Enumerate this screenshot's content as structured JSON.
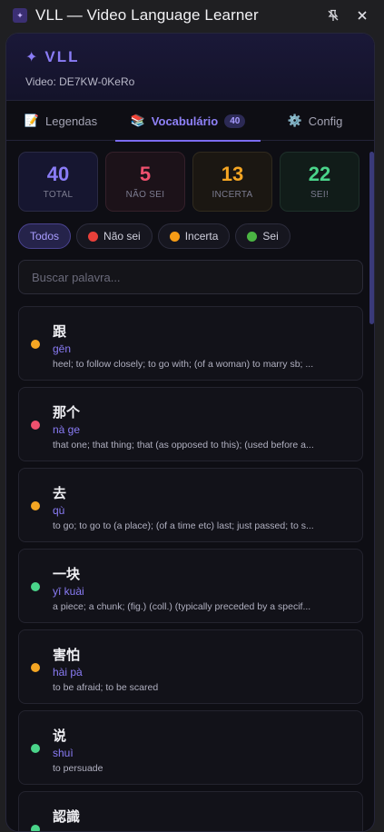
{
  "window": {
    "title": "VLL — Video Language Learner",
    "icon": "app-logo-icon",
    "pin_icon": "pin-off-icon",
    "close_icon": "close-icon"
  },
  "header": {
    "brand_icon": "✦",
    "brand": "VLL",
    "video_label": "Video: DE7KW-0KeRo"
  },
  "tabs": [
    {
      "icon": "📝",
      "label": "Legendas",
      "active": false
    },
    {
      "icon": "📚",
      "label": "Vocabulário",
      "badge": "40",
      "active": true
    },
    {
      "icon": "⚙️",
      "label": "Config",
      "active": false
    }
  ],
  "stats": [
    {
      "value": "40",
      "label": "TOTAL",
      "color": "#8a7cf6"
    },
    {
      "value": "5",
      "label": "NÃO SEI",
      "color": "#f0506e"
    },
    {
      "value": "13",
      "label": "INCERTA",
      "color": "#f5a623"
    },
    {
      "value": "22",
      "label": "SEI!",
      "color": "#4ad48a"
    }
  ],
  "filters": [
    {
      "label": "Todos",
      "active": true
    },
    {
      "label": "Não sei",
      "dot": "#e8403a",
      "active": false
    },
    {
      "label": "Incerta",
      "dot": "#f59b16",
      "active": false
    },
    {
      "label": "Sei",
      "dot": "#4bb543",
      "active": false
    }
  ],
  "search": {
    "placeholder": "Buscar palavra...",
    "value": ""
  },
  "words": [
    {
      "word": "跟",
      "pinyin": "gēn",
      "definition": "heel; to follow closely; to go with; (of a woman) to marry sb; ...",
      "status_color": "#f5a623"
    },
    {
      "word": "那个",
      "pinyin": "nà ge",
      "definition": "that one; that thing; that (as opposed to this); (used before a...",
      "status_color": "#f0506e"
    },
    {
      "word": "去",
      "pinyin": "qù",
      "definition": "to go; to go to (a place); (of a time etc) last; just passed; to s...",
      "status_color": "#f5a623"
    },
    {
      "word": "一块",
      "pinyin": "yī kuài",
      "definition": "a piece; a chunk; (fig.) (coll.) (typically preceded by a specif...",
      "status_color": "#4ad48a"
    },
    {
      "word": "害怕",
      "pinyin": "hài pà",
      "definition": "to be afraid; to be scared",
      "status_color": "#f5a623"
    },
    {
      "word": "说",
      "pinyin": "shuì",
      "definition": "to persuade",
      "status_color": "#4ad48a"
    },
    {
      "word": "認識",
      "pinyin": "",
      "definition": "",
      "status_color": "#4ad48a"
    }
  ],
  "colors": {
    "accent": "#7b6cf0",
    "background": "#0e0e14"
  }
}
